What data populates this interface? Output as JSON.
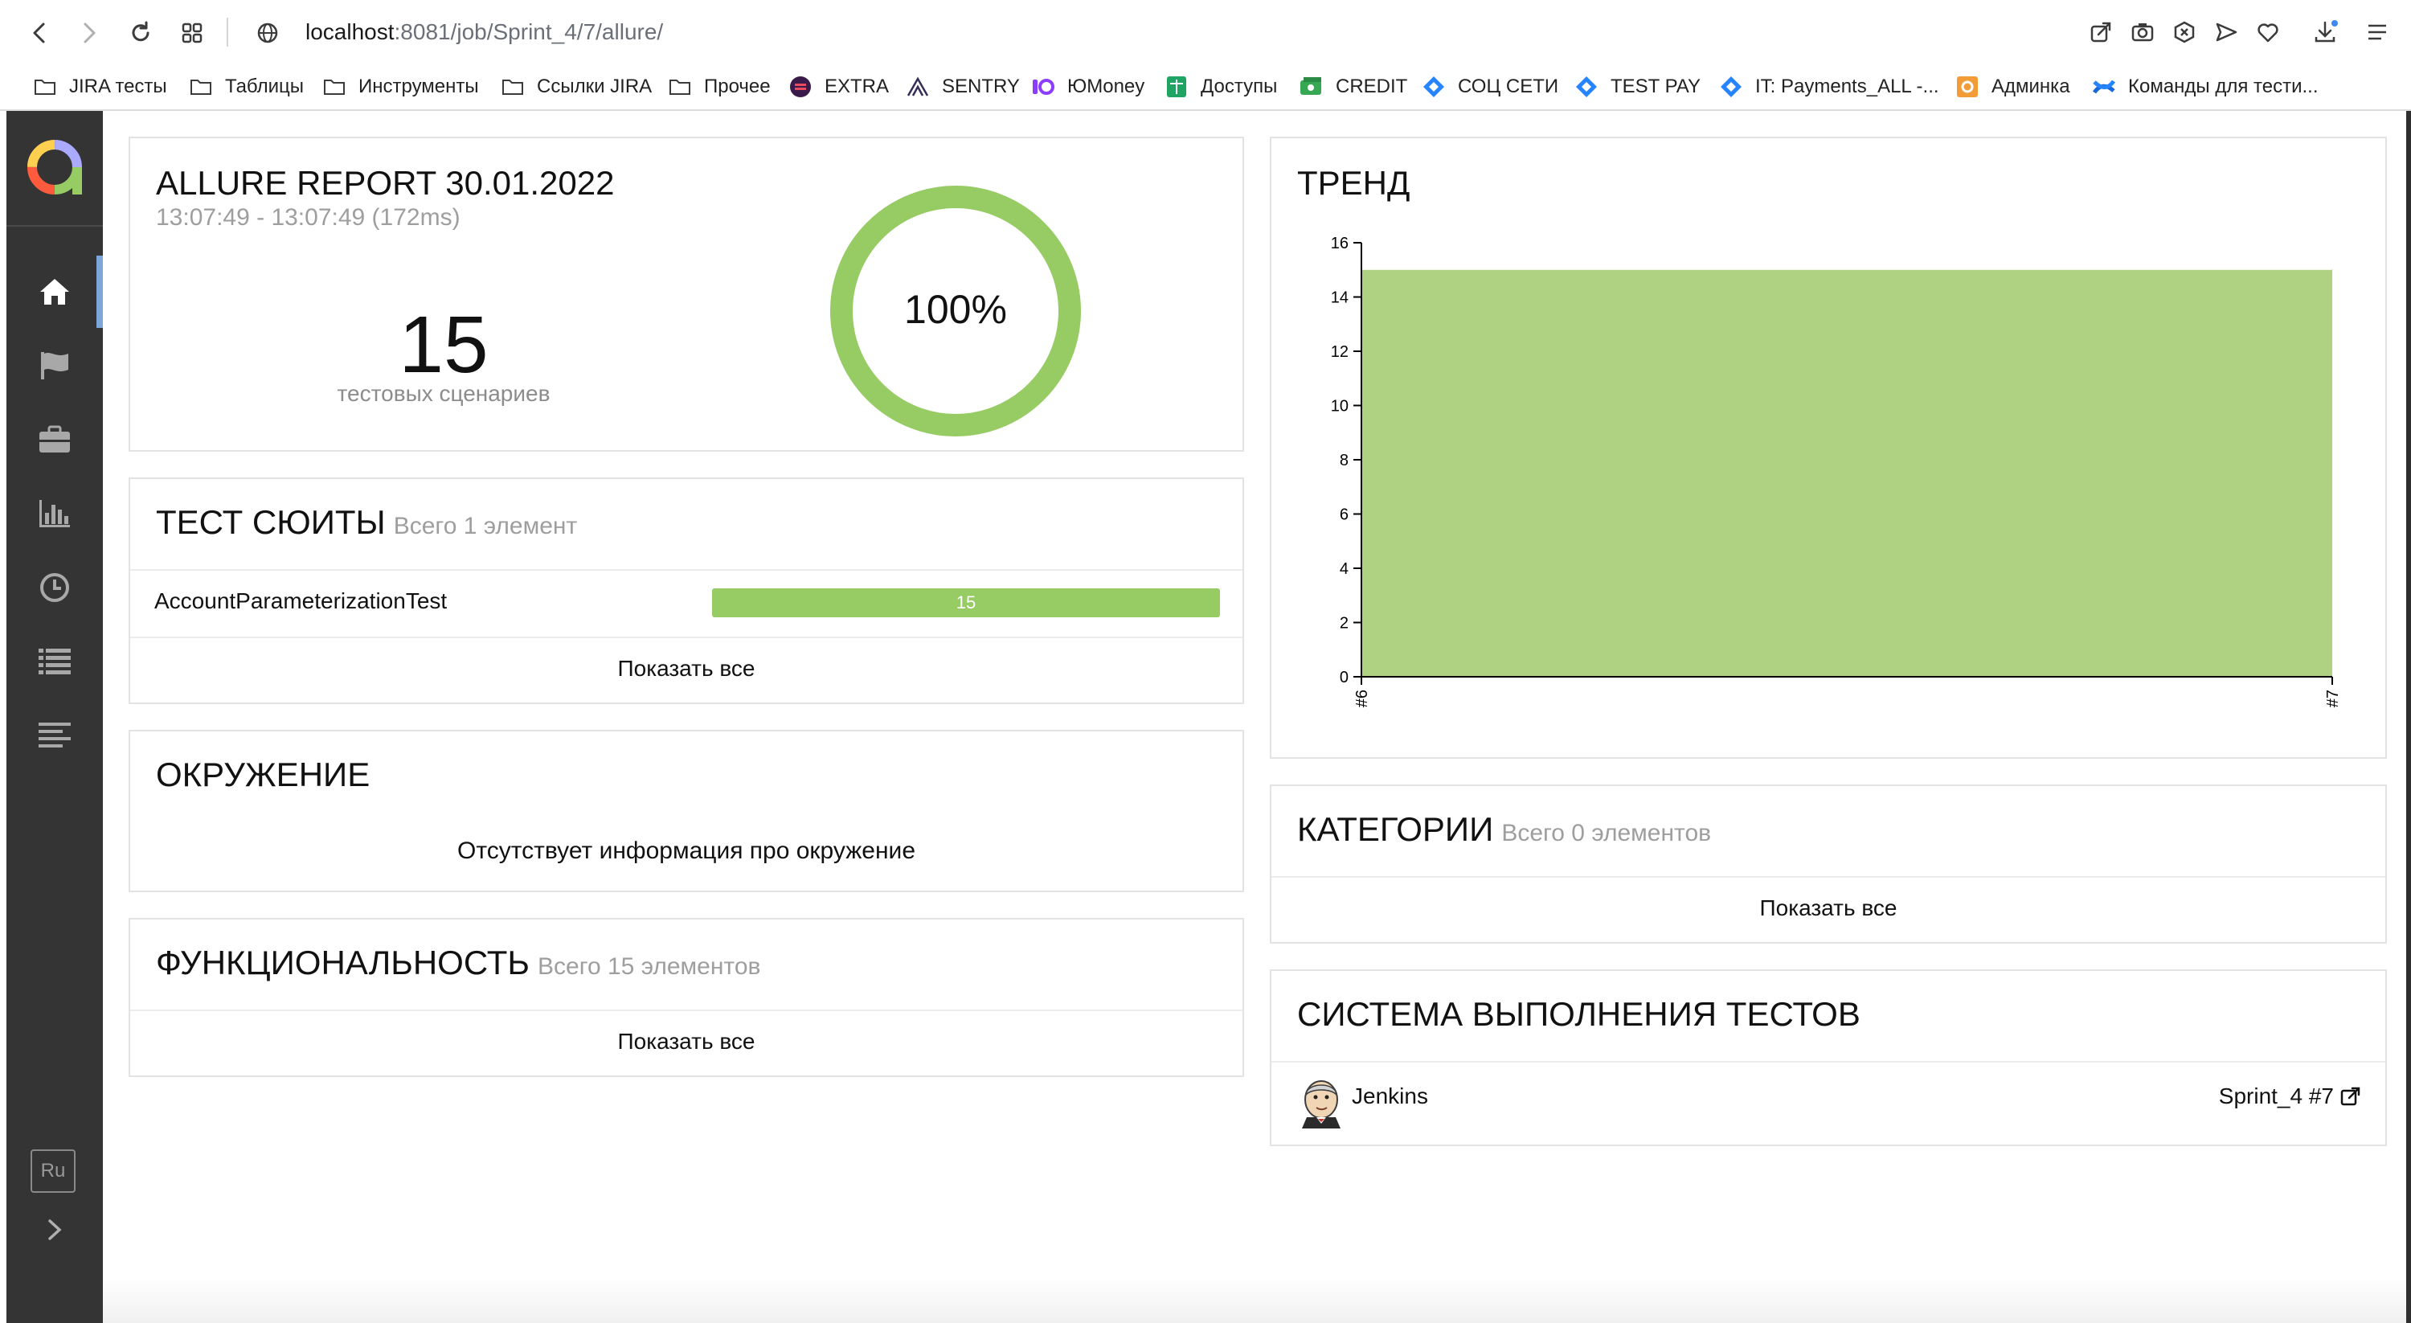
{
  "browser": {
    "url_host": "localhost",
    "url_path": ":8081/job/Sprint_4/7/allure/"
  },
  "bookmarks": [
    {
      "label": "JIRA  тесты",
      "icon": "folder-icon"
    },
    {
      "label": "Таблицы",
      "icon": "folder-icon"
    },
    {
      "label": "Инструменты",
      "icon": "folder-icon"
    },
    {
      "label": "Ссылки JIRA",
      "icon": "folder-icon"
    },
    {
      "label": "Прочее",
      "icon": "folder-icon"
    },
    {
      "label": "EXTRA",
      "icon": "extra-icon"
    },
    {
      "label": "SENTRY",
      "icon": "sentry-icon"
    },
    {
      "label": "ЮMoney",
      "icon": "yumoney-icon"
    },
    {
      "label": "Доступы",
      "icon": "sheets-icon"
    },
    {
      "label": "CREDIT",
      "icon": "credit-icon"
    },
    {
      "label": "СОЦ СЕТИ",
      "icon": "jira-icon"
    },
    {
      "label": "TEST PAY",
      "icon": "jira-icon"
    },
    {
      "label": "IT: Payments_ALL -...",
      "icon": "jira-icon"
    },
    {
      "label": "Админка",
      "icon": "admin-icon"
    },
    {
      "label": "Команды для тести...",
      "icon": "confluence-icon"
    }
  ],
  "sidebar": {
    "items": [
      "home-icon",
      "flag-icon",
      "briefcase-icon",
      "bar-chart-icon",
      "clock-icon",
      "list-icon",
      "align-left-icon"
    ],
    "active_index": 0,
    "lang_label": "Ru"
  },
  "summary": {
    "title": "ALLURE REPORT 30.01.2022",
    "time": "13:07:49 - 13:07:49 (172ms)",
    "count": "15",
    "count_label": "тестовых сценариев",
    "percent_label": "100%",
    "passed_fraction": 1.0
  },
  "suites": {
    "title": "ТЕСТ СЮИТЫ",
    "subtitle": "Всего 1 элемент",
    "rows": [
      {
        "name": "AccountParameterizationTest",
        "passed": "15"
      }
    ],
    "show_all": "Показать все"
  },
  "environment": {
    "title": "ОКРУЖЕНИЕ",
    "empty_text": "Отсутствует информация про окружение"
  },
  "features": {
    "title": "ФУНКЦИОНАЛЬНОСТЬ",
    "subtitle": "Всего 15 элементов",
    "show_all": "Показать все"
  },
  "trend": {
    "title": "ТРЕНД"
  },
  "categories": {
    "title": "КАТЕГОРИИ",
    "subtitle": "Всего 0 элементов",
    "show_all": "Показать все"
  },
  "executors": {
    "title": "СИСТЕМА ВЫПОЛНЕНИЯ ТЕСТОВ",
    "name": "Jenkins",
    "build": "Sprint_4 #7"
  },
  "colors": {
    "passed": "#97cc64",
    "trend_fill": "#aed281",
    "sidebar": "#343434",
    "active_marker": "#7ba8d9"
  },
  "chart_data": {
    "type": "area",
    "title": "ТРЕНД",
    "x": [
      "#6",
      "#7"
    ],
    "series": [
      {
        "values": [
          15,
          15
        ]
      }
    ],
    "ylim": [
      0,
      16
    ],
    "yticks": [
      0,
      2,
      4,
      6,
      8,
      10,
      12,
      14,
      16
    ],
    "grid": false
  }
}
